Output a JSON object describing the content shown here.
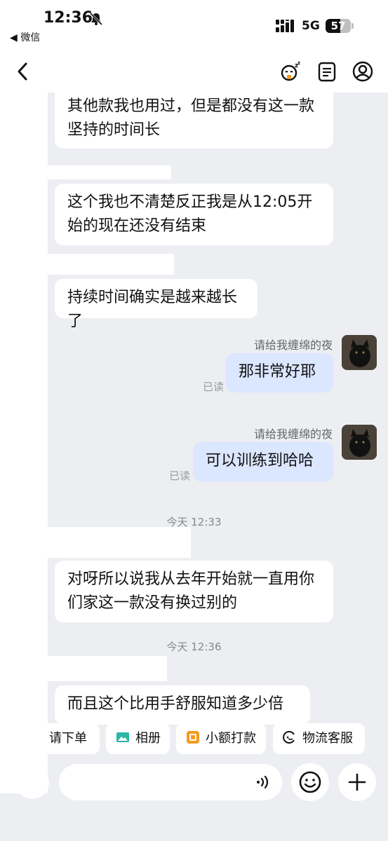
{
  "status_bar": {
    "time": "12:36",
    "back_app": "◀ 微信",
    "network": "5G",
    "battery": "57",
    "battery_level": 0.57
  },
  "nav": {
    "title": "",
    "icons": [
      "back-icon",
      "sleep-mode-icon",
      "notes-icon",
      "profile-icon"
    ]
  },
  "messages": [
    {
      "side": "left",
      "text": "其他款我也用过，但是都没有这一款坚持的时间长"
    },
    {
      "side": "left",
      "text": "这个我也不清楚反正我是从12:05开始的现在还没有结束"
    },
    {
      "side": "left",
      "text": "持续时间确实是越来越长了"
    },
    {
      "side": "right",
      "sender": "请给我缠绵的夜",
      "text": "那非常好耶",
      "read": "已读"
    },
    {
      "side": "right",
      "sender": "请给我缠绵的夜",
      "text": "可以训练到哈哈",
      "read": "已读"
    },
    {
      "side": "time",
      "text": "今天 12:33"
    },
    {
      "side": "left",
      "text": "对呀所以说我从去年开始就一直用你们家这一款没有换过别的"
    },
    {
      "side": "time",
      "text": "今天 12:36"
    },
    {
      "side": "left",
      "text": "而且这个比用手舒服知道多少倍"
    }
  ],
  "quick_actions": [
    {
      "label": "请下单",
      "icon": "order-icon"
    },
    {
      "label": "相册",
      "icon": "album-icon"
    },
    {
      "label": "小额打款",
      "icon": "payment-icon"
    },
    {
      "label": "物流客服",
      "icon": "logistics-service-icon"
    }
  ],
  "colors": {
    "background": "#eceef2",
    "my_bubble": "#dbe6ff",
    "their_bubble": "#ffffff",
    "album_icon": "#2bb5a6",
    "payment_icon": "#f39a1e"
  }
}
